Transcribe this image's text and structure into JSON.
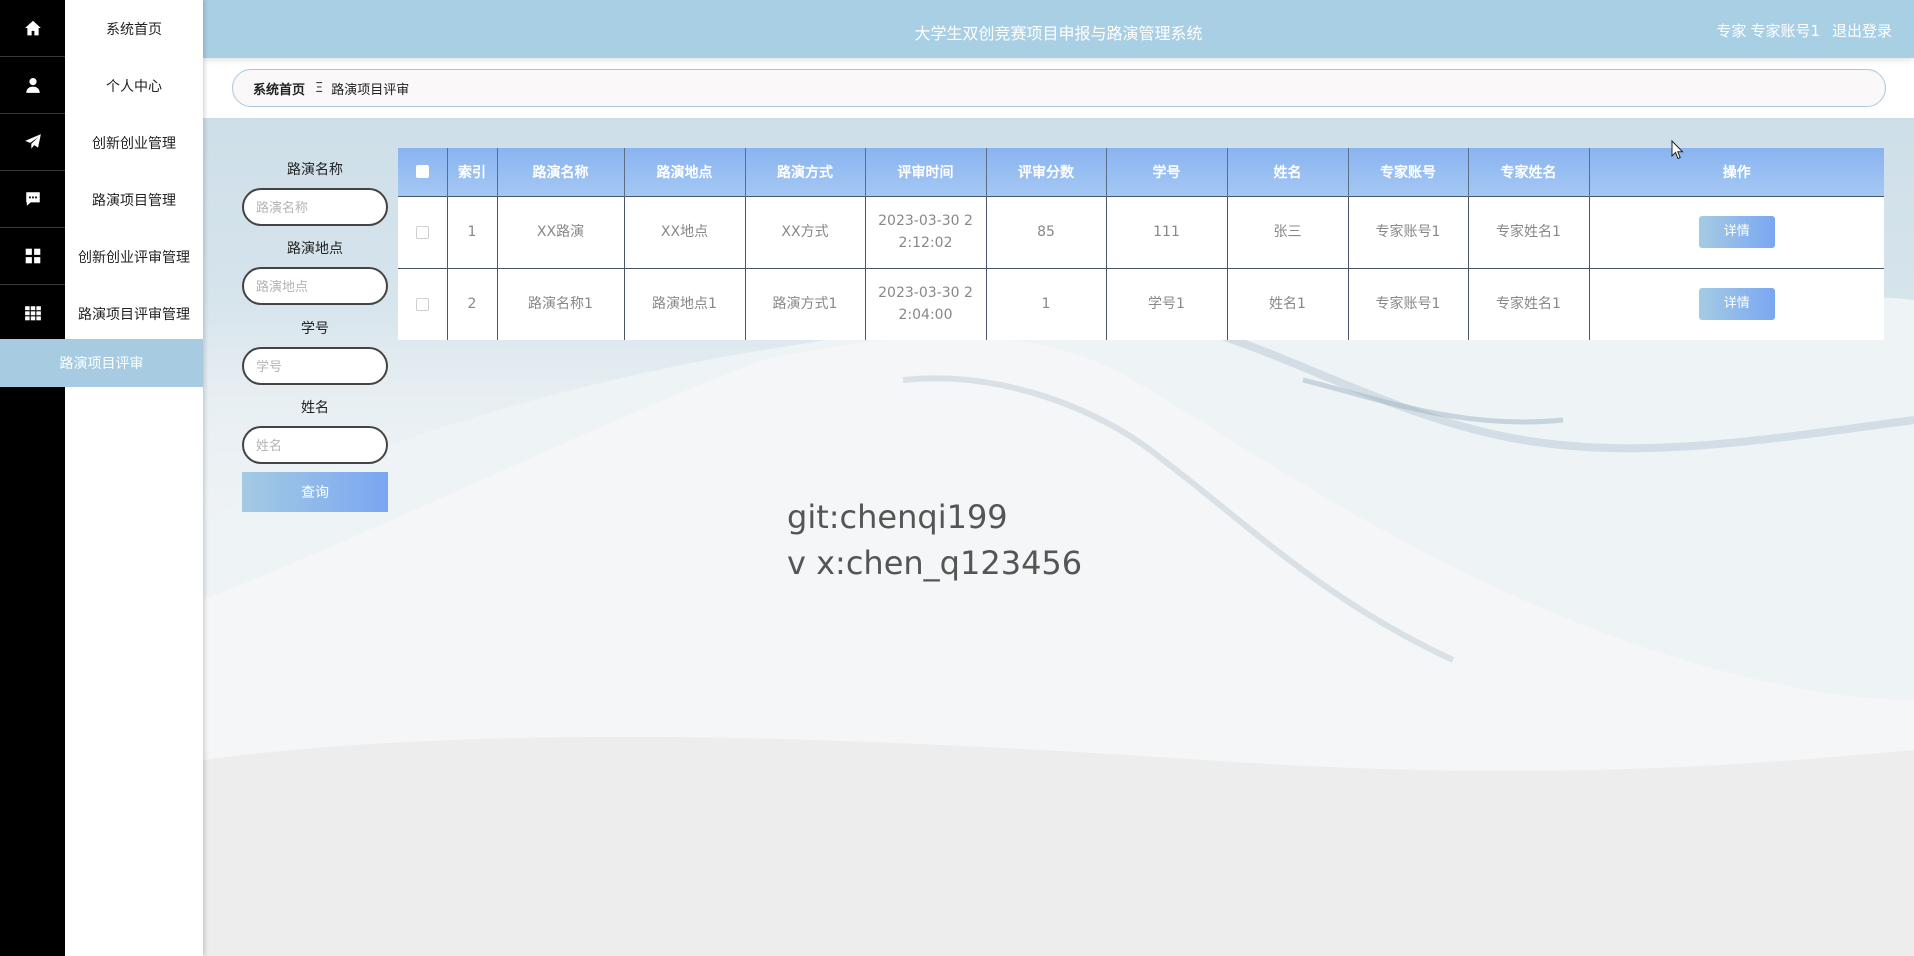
{
  "app": {
    "title": "大学生双创竞赛项目申报与路演管理系统"
  },
  "topbar": {
    "role": "专家",
    "account": "专家账号1",
    "logout": "退出登录"
  },
  "sidebar": {
    "items": [
      {
        "label": "系统首页",
        "icon": "home-icon"
      },
      {
        "label": "个人中心",
        "icon": "user-icon"
      },
      {
        "label": "创新创业管理",
        "icon": "paper-plane-icon"
      },
      {
        "label": "路演项目管理",
        "icon": "chat-icon"
      },
      {
        "label": "创新创业评审管理",
        "icon": "grid-icon"
      },
      {
        "label": "路演项目评审管理",
        "icon": "table-grid-icon"
      }
    ],
    "active_sub": "路演项目评审"
  },
  "breadcrumb": {
    "home": "系统首页",
    "separator": "Ξ",
    "current": "路演项目评审"
  },
  "search": {
    "fields": [
      {
        "label": "路演名称",
        "placeholder": "路演名称"
      },
      {
        "label": "路演地点",
        "placeholder": "路演地点"
      },
      {
        "label": "学号",
        "placeholder": "学号"
      },
      {
        "label": "姓名",
        "placeholder": "姓名"
      }
    ],
    "query_label": "查询"
  },
  "table": {
    "columns": [
      "索引",
      "路演名称",
      "路演地点",
      "路演方式",
      "评审时间",
      "评审分数",
      "学号",
      "姓名",
      "专家账号",
      "专家姓名",
      "操作"
    ],
    "rows": [
      {
        "index": "1",
        "name": "XX路演",
        "place": "XX地点",
        "mode": "XX方式",
        "time": "2023-03-30 22:12:02",
        "score": "85",
        "student_no": "111",
        "student_name": "张三",
        "expert_account": "专家账号1",
        "expert_name": "专家姓名1",
        "action": "详情"
      },
      {
        "index": "2",
        "name": "路演名称1",
        "place": "路演地点1",
        "mode": "路演方式1",
        "time": "2023-03-30 22:04:00",
        "score": "1",
        "student_no": "学号1",
        "student_name": "姓名1",
        "expert_account": "专家账号1",
        "expert_name": "专家姓名1",
        "action": "详情"
      }
    ]
  },
  "watermark": {
    "line1": "git:chenqi199",
    "line2": "v x:chen_q123456"
  },
  "colors": {
    "topbar": "#a9cfe4",
    "accent_start": "#a4cbe3",
    "accent_end": "#7aa6f2",
    "rail": "#000000"
  }
}
